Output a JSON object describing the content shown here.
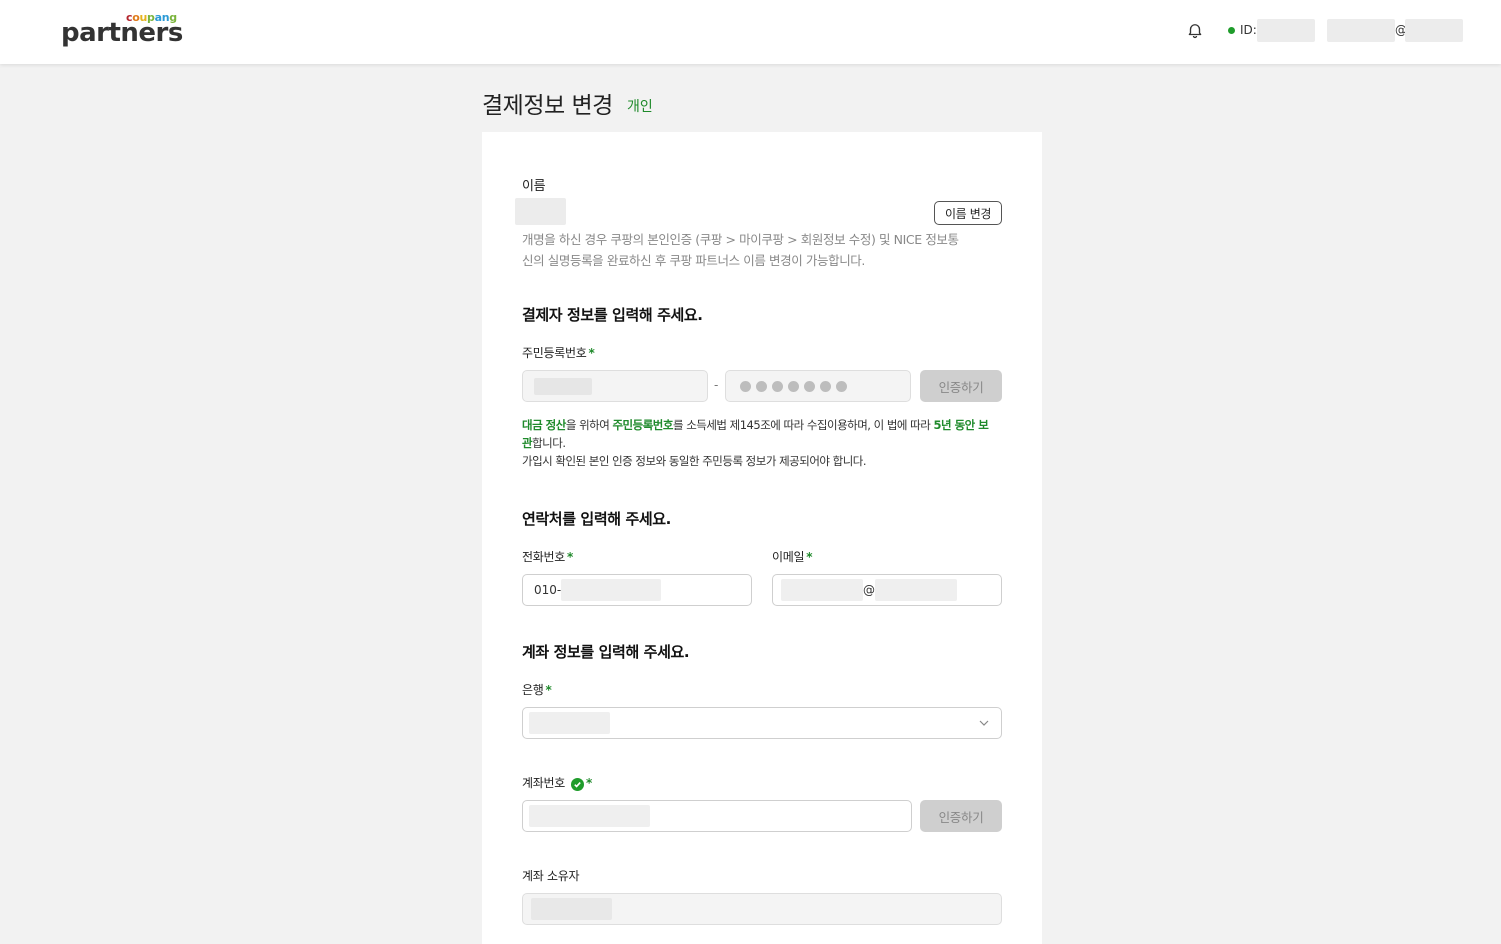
{
  "header": {
    "logo_small": "coupang",
    "logo_main": "partners",
    "id_label": "ID:",
    "email_at": "@"
  },
  "page": {
    "title": "결제정보 변경",
    "subtitle": "개인"
  },
  "name_section": {
    "label": "이름",
    "change_button": "이름 변경",
    "note": "개명을 하신 경우 쿠팡의 본인인증 (쿠팡 > 마이쿠팡 > 회원정보 수정) 및 NICE 정보통신의 실명등록을 완료하신 후 쿠팡 파트너스 이름 변경이 가능합니다."
  },
  "payer_section": {
    "title": "결제자 정보를 입력해 주세요.",
    "rrn_label": "주민등록번호",
    "required_mark": "*",
    "dash": "-",
    "verify_button": "인증하기",
    "notice_part1": "대금 정산",
    "notice_part2": "을 위하여 ",
    "notice_part3": "주민등록번호",
    "notice_part4": "를 소득세법 제145조에 따라 수집이용하며, 이 법에 따라 ",
    "notice_part5": "5년 동안 보관",
    "notice_part6": "합니다.",
    "notice_line2": "가입시 확인된 본인 인증 정보와 동일한 주민등록 정보가 제공되어야 합니다."
  },
  "contact_section": {
    "title": "연락처를 입력해 주세요.",
    "phone_label": "전화번호",
    "phone_prefix": "010-",
    "email_label": "이메일",
    "email_at": "@"
  },
  "account_section": {
    "title": "계좌 정보를 입력해 주세요.",
    "bank_label": "은행",
    "account_label": "계좌번호",
    "verify_button": "인증하기",
    "holder_label": "계좌 소유자"
  },
  "colors": {
    "accent_green": "#1f8a2b",
    "coupang_c": "#b3262e",
    "coupang_o": "#e07b1a",
    "coupang_u": "#e5b31c",
    "coupang_p": "#7ab33b",
    "coupang_a": "#2b9ad6",
    "coupang_n": "#2b9ad6",
    "coupang_g": "#7ab33b"
  },
  "icons": {
    "notification": "bell-icon",
    "online_status": "status-dot",
    "dropdown": "chevron-down-icon",
    "verified": "check-circle-icon"
  }
}
